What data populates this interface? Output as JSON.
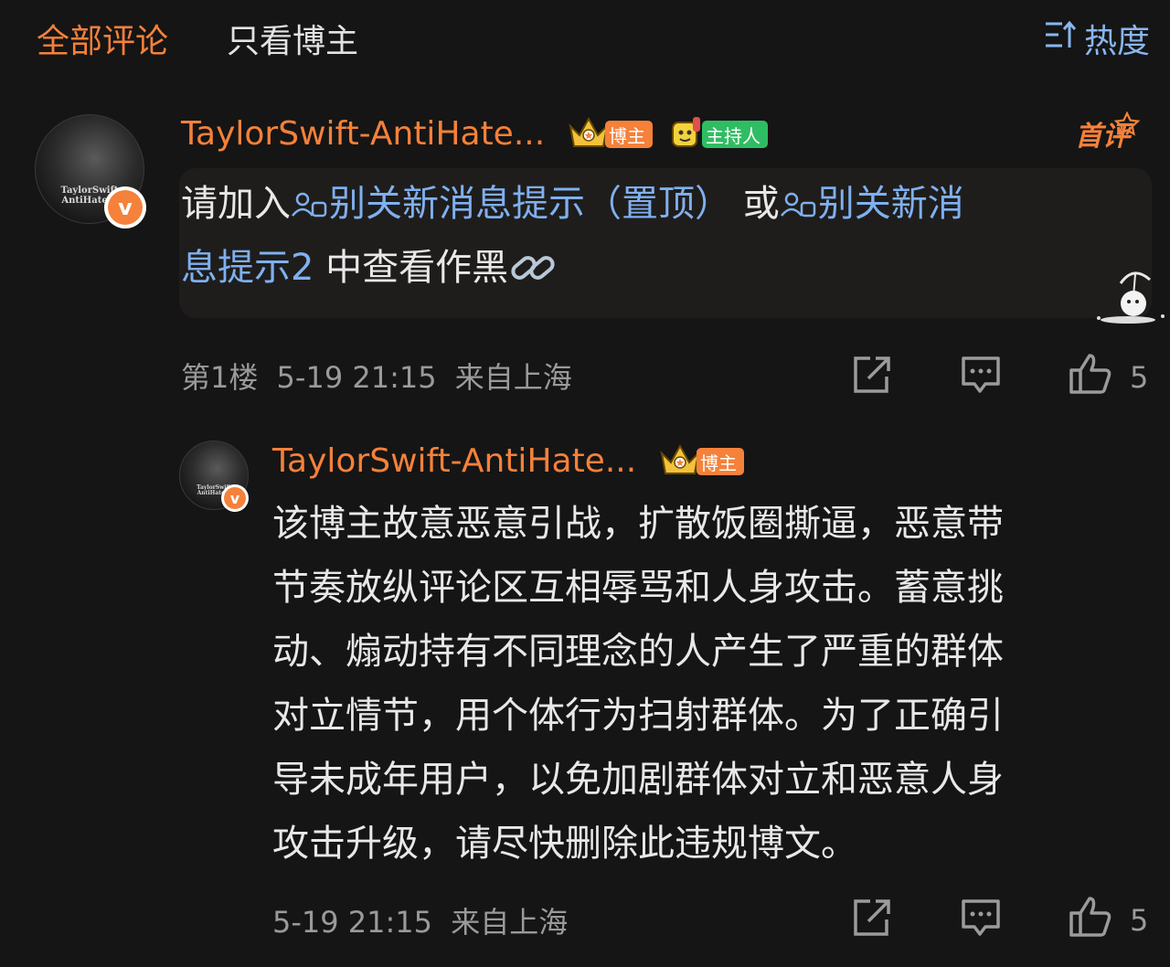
{
  "tabs": {
    "all_comments": "全部评论",
    "owner_only": "只看博主"
  },
  "sort": {
    "label": "热度",
    "icon": "sort-icon"
  },
  "comment1": {
    "avatar_text_line1": "TaylorSwift",
    "avatar_text_line2": "AntiHaters",
    "username": "TaylorSwift-AntiHate...",
    "tag_owner": "博主",
    "tag_host": "主持人",
    "first_badge": "首评",
    "text_prefix": "请加入",
    "link1": "别关新消息提示（置顶）",
    "text_or": " 或",
    "link2a": "别关新消",
    "link2b": "息提示2",
    "text_suffix": " 中查看作黑",
    "floor": "第1楼",
    "datetime": "5-19 21:15",
    "location": "来自上海",
    "likes": "5"
  },
  "reply1": {
    "avatar_text_line1": "TaylorSwift",
    "avatar_text_line2": "AntiHaters",
    "username": "TaylorSwift-AntiHate...",
    "tag_owner": "博主",
    "lines": [
      "该博主故意恶意引战，扩散饭圈撕逼，恶意带",
      "节奏放纵评论区互相辱骂和人身攻击。蓄意挑",
      "动、煽动持有不同理念的人产生了严重的群体",
      "对立情节，用个体行为扫射群体。为了正确引",
      "导未成年用户，以免加剧群体对立和恶意人身",
      "攻击升级，请尽快删除此违规博文。"
    ],
    "datetime": "5-19 21:15",
    "location": "来自上海",
    "likes": "5"
  },
  "colors": {
    "accent": "#f5813a",
    "link": "#7fb0f0",
    "background": "#151515",
    "host_tag": "#2fbd63"
  }
}
